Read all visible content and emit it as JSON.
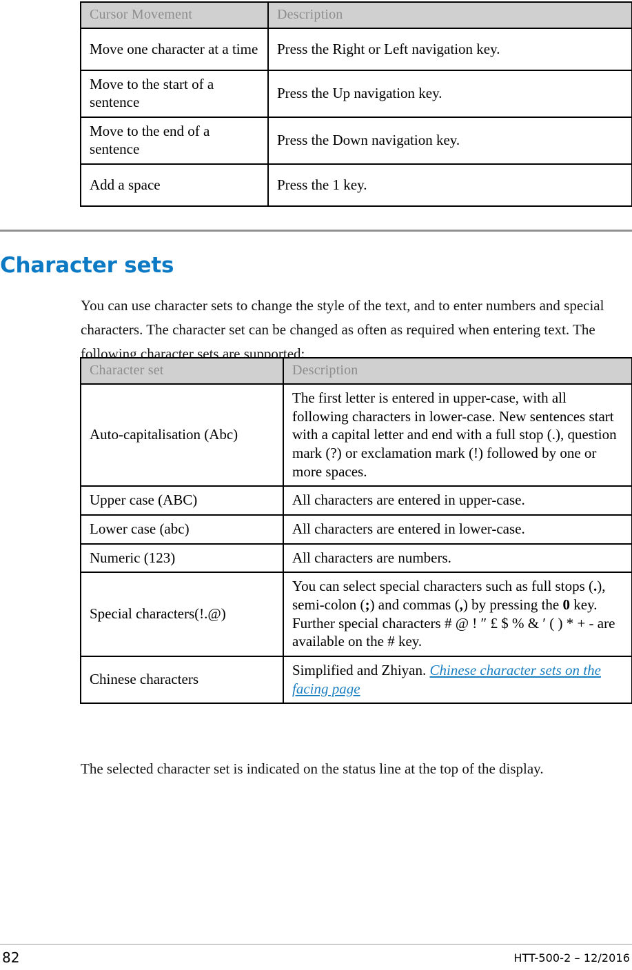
{
  "document": {
    "footer": {
      "page_number": "82",
      "doc_reference": "HTT-500-2 – 12/2016"
    }
  },
  "cursor_table": {
    "headers": [
      "Cursor Movement",
      "Description"
    ],
    "rows": [
      {
        "movement": "Move one character at a time",
        "description": "Press the Right or Left navigation key."
      },
      {
        "movement": "Move to the start of a sentence",
        "description": "Press the Up navigation key."
      },
      {
        "movement": "Move to the end of a sentence",
        "description": "Press the Down navigation key."
      },
      {
        "movement": "Add a space",
        "description": "Press the 1 key."
      }
    ]
  },
  "section": {
    "heading": "Character sets",
    "intro_paragraph": "You can use character sets to change the style of the text, and to enter numbers and special characters. The character set can be changed as often as required when entering text. The following character sets are supported:",
    "outro_paragraph": "The selected character set is indicated on the status line at the top of the display."
  },
  "charset_table": {
    "headers": [
      "Character set",
      "Description"
    ],
    "rows": [
      {
        "name": "Auto-capitalisation (Abc)",
        "description": "The first letter is entered in upper-case, with all following characters in lower-case. New sentences start with a capital letter and end with a full stop (.), question mark (?) or exclamation mark (!) followed by one or more spaces."
      },
      {
        "name": "Upper case (ABC)",
        "description": "All characters are entered in upper-case."
      },
      {
        "name": "Lower case (abc)",
        "description": "All characters are entered in lower-case."
      },
      {
        "name": "Numeric (123)",
        "description": "All characters are numbers."
      },
      {
        "name": "Special characters(!.@)",
        "description_parts": {
          "p1": "You can select special characters such as full stops (",
          "b1": ".",
          "p2": "), semi-colon (",
          "b2": ";",
          "p3": ") and commas (",
          "b3": ",",
          "p4": ") by pressing the ",
          "b4": "0",
          "p5": " key. Further special characters # @ ! ″ £ $ % & ′ ( ) * + - are available on the # key."
        }
      },
      {
        "name": "Chinese characters",
        "description_prefix": "Simplified and Zhiyan. ",
        "description_link": "Chinese character sets on the facing page"
      }
    ]
  },
  "colors": {
    "heading_blue": "#0b79c3",
    "link_blue": "#1a7fc1",
    "table_header_bg": "#d0d0d0",
    "table_header_text": "#8d8d8d",
    "rule_gray": "#919191"
  }
}
